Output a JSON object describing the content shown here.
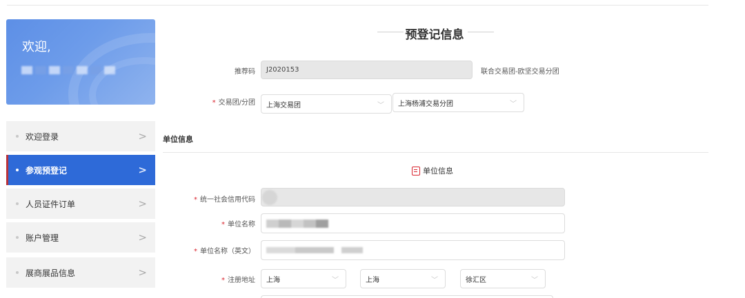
{
  "welcome": {
    "title": "欢迎,"
  },
  "sidebar": {
    "items": [
      {
        "label": "欢迎登录",
        "arrow": ">"
      },
      {
        "label": "参观预登记",
        "arrow": ">",
        "active": true
      },
      {
        "label": "人员证件订单",
        "arrow": ">"
      },
      {
        "label": "账户管理",
        "arrow": ">"
      },
      {
        "label": "展商展品信息",
        "arrow": ">"
      }
    ]
  },
  "main": {
    "title": "预登记信息",
    "referral": {
      "label": "推荐码",
      "value": "J2020153",
      "group_note": "联合交易团-欧坚交易分团"
    },
    "trade_group": {
      "label": "交易团/分团",
      "group_value": "上海交易团",
      "subgroup_value": "上海杨浦交易分团"
    },
    "unit_section_heading": "单位信息",
    "unit_panel_title": "单位信息",
    "unit_fields": {
      "credit_code_label": "统一社会信用代码",
      "name_label": "单位名称",
      "name_en_label": "单位名称（英文）",
      "address_label": "注册地址",
      "address_province": "上海",
      "address_city": "上海",
      "address_district": "徐汇区"
    }
  },
  "icons": {
    "arrow": "chevron-right-icon",
    "select": "chevron-down-icon",
    "unit": "document-icon"
  },
  "colors": {
    "accent": "#2e6ad8",
    "required": "#d9232d",
    "active_marker": "#b8323a"
  }
}
